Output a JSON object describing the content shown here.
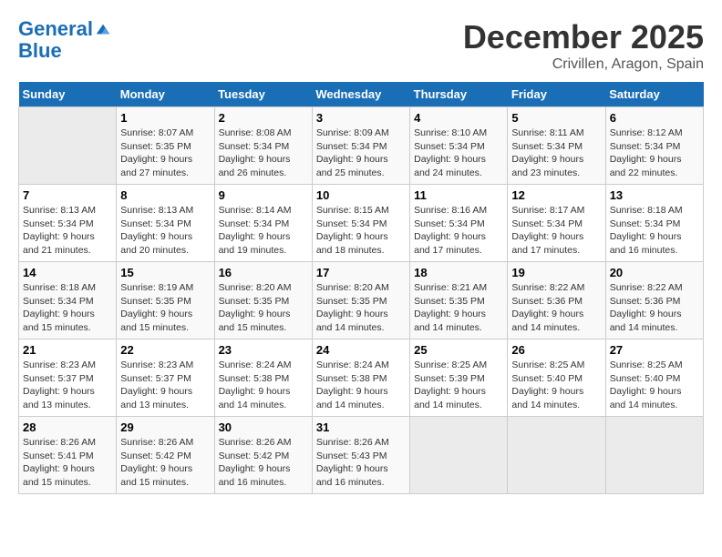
{
  "logo": {
    "line1": "General",
    "line2": "Blue"
  },
  "title": "December 2025",
  "location": "Crivillen, Aragon, Spain",
  "days_of_week": [
    "Sunday",
    "Monday",
    "Tuesday",
    "Wednesday",
    "Thursday",
    "Friday",
    "Saturday"
  ],
  "weeks": [
    [
      {
        "day": "",
        "sunrise": "",
        "sunset": "",
        "daylight": ""
      },
      {
        "day": "1",
        "sunrise": "Sunrise: 8:07 AM",
        "sunset": "Sunset: 5:35 PM",
        "daylight": "Daylight: 9 hours and 27 minutes."
      },
      {
        "day": "2",
        "sunrise": "Sunrise: 8:08 AM",
        "sunset": "Sunset: 5:34 PM",
        "daylight": "Daylight: 9 hours and 26 minutes."
      },
      {
        "day": "3",
        "sunrise": "Sunrise: 8:09 AM",
        "sunset": "Sunset: 5:34 PM",
        "daylight": "Daylight: 9 hours and 25 minutes."
      },
      {
        "day": "4",
        "sunrise": "Sunrise: 8:10 AM",
        "sunset": "Sunset: 5:34 PM",
        "daylight": "Daylight: 9 hours and 24 minutes."
      },
      {
        "day": "5",
        "sunrise": "Sunrise: 8:11 AM",
        "sunset": "Sunset: 5:34 PM",
        "daylight": "Daylight: 9 hours and 23 minutes."
      },
      {
        "day": "6",
        "sunrise": "Sunrise: 8:12 AM",
        "sunset": "Sunset: 5:34 PM",
        "daylight": "Daylight: 9 hours and 22 minutes."
      }
    ],
    [
      {
        "day": "7",
        "sunrise": "Sunrise: 8:13 AM",
        "sunset": "Sunset: 5:34 PM",
        "daylight": "Daylight: 9 hours and 21 minutes."
      },
      {
        "day": "8",
        "sunrise": "Sunrise: 8:13 AM",
        "sunset": "Sunset: 5:34 PM",
        "daylight": "Daylight: 9 hours and 20 minutes."
      },
      {
        "day": "9",
        "sunrise": "Sunrise: 8:14 AM",
        "sunset": "Sunset: 5:34 PM",
        "daylight": "Daylight: 9 hours and 19 minutes."
      },
      {
        "day": "10",
        "sunrise": "Sunrise: 8:15 AM",
        "sunset": "Sunset: 5:34 PM",
        "daylight": "Daylight: 9 hours and 18 minutes."
      },
      {
        "day": "11",
        "sunrise": "Sunrise: 8:16 AM",
        "sunset": "Sunset: 5:34 PM",
        "daylight": "Daylight: 9 hours and 17 minutes."
      },
      {
        "day": "12",
        "sunrise": "Sunrise: 8:17 AM",
        "sunset": "Sunset: 5:34 PM",
        "daylight": "Daylight: 9 hours and 17 minutes."
      },
      {
        "day": "13",
        "sunrise": "Sunrise: 8:18 AM",
        "sunset": "Sunset: 5:34 PM",
        "daylight": "Daylight: 9 hours and 16 minutes."
      }
    ],
    [
      {
        "day": "14",
        "sunrise": "Sunrise: 8:18 AM",
        "sunset": "Sunset: 5:34 PM",
        "daylight": "Daylight: 9 hours and 15 minutes."
      },
      {
        "day": "15",
        "sunrise": "Sunrise: 8:19 AM",
        "sunset": "Sunset: 5:35 PM",
        "daylight": "Daylight: 9 hours and 15 minutes."
      },
      {
        "day": "16",
        "sunrise": "Sunrise: 8:20 AM",
        "sunset": "Sunset: 5:35 PM",
        "daylight": "Daylight: 9 hours and 15 minutes."
      },
      {
        "day": "17",
        "sunrise": "Sunrise: 8:20 AM",
        "sunset": "Sunset: 5:35 PM",
        "daylight": "Daylight: 9 hours and 14 minutes."
      },
      {
        "day": "18",
        "sunrise": "Sunrise: 8:21 AM",
        "sunset": "Sunset: 5:35 PM",
        "daylight": "Daylight: 9 hours and 14 minutes."
      },
      {
        "day": "19",
        "sunrise": "Sunrise: 8:22 AM",
        "sunset": "Sunset: 5:36 PM",
        "daylight": "Daylight: 9 hours and 14 minutes."
      },
      {
        "day": "20",
        "sunrise": "Sunrise: 8:22 AM",
        "sunset": "Sunset: 5:36 PM",
        "daylight": "Daylight: 9 hours and 14 minutes."
      }
    ],
    [
      {
        "day": "21",
        "sunrise": "Sunrise: 8:23 AM",
        "sunset": "Sunset: 5:37 PM",
        "daylight": "Daylight: 9 hours and 13 minutes."
      },
      {
        "day": "22",
        "sunrise": "Sunrise: 8:23 AM",
        "sunset": "Sunset: 5:37 PM",
        "daylight": "Daylight: 9 hours and 13 minutes."
      },
      {
        "day": "23",
        "sunrise": "Sunrise: 8:24 AM",
        "sunset": "Sunset: 5:38 PM",
        "daylight": "Daylight: 9 hours and 14 minutes."
      },
      {
        "day": "24",
        "sunrise": "Sunrise: 8:24 AM",
        "sunset": "Sunset: 5:38 PM",
        "daylight": "Daylight: 9 hours and 14 minutes."
      },
      {
        "day": "25",
        "sunrise": "Sunrise: 8:25 AM",
        "sunset": "Sunset: 5:39 PM",
        "daylight": "Daylight: 9 hours and 14 minutes."
      },
      {
        "day": "26",
        "sunrise": "Sunrise: 8:25 AM",
        "sunset": "Sunset: 5:40 PM",
        "daylight": "Daylight: 9 hours and 14 minutes."
      },
      {
        "day": "27",
        "sunrise": "Sunrise: 8:25 AM",
        "sunset": "Sunset: 5:40 PM",
        "daylight": "Daylight: 9 hours and 14 minutes."
      }
    ],
    [
      {
        "day": "28",
        "sunrise": "Sunrise: 8:26 AM",
        "sunset": "Sunset: 5:41 PM",
        "daylight": "Daylight: 9 hours and 15 minutes."
      },
      {
        "day": "29",
        "sunrise": "Sunrise: 8:26 AM",
        "sunset": "Sunset: 5:42 PM",
        "daylight": "Daylight: 9 hours and 15 minutes."
      },
      {
        "day": "30",
        "sunrise": "Sunrise: 8:26 AM",
        "sunset": "Sunset: 5:42 PM",
        "daylight": "Daylight: 9 hours and 16 minutes."
      },
      {
        "day": "31",
        "sunrise": "Sunrise: 8:26 AM",
        "sunset": "Sunset: 5:43 PM",
        "daylight": "Daylight: 9 hours and 16 minutes."
      },
      {
        "day": "",
        "sunrise": "",
        "sunset": "",
        "daylight": ""
      },
      {
        "day": "",
        "sunrise": "",
        "sunset": "",
        "daylight": ""
      },
      {
        "day": "",
        "sunrise": "",
        "sunset": "",
        "daylight": ""
      }
    ]
  ]
}
